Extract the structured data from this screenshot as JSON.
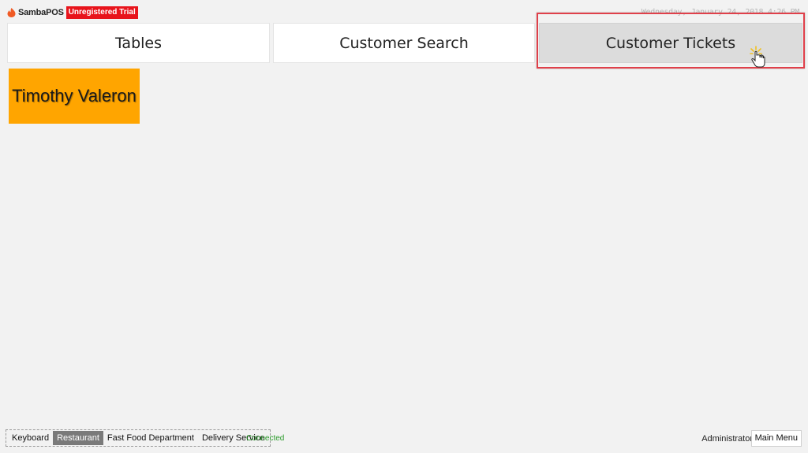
{
  "header": {
    "app_name": "SambaPOS",
    "trial_badge": "Unregistered Trial",
    "datetime": "Wednesday, January 24, 2018 4:26 PM"
  },
  "nav": {
    "buttons": [
      {
        "label": "Tables"
      },
      {
        "label": "Customer Search"
      },
      {
        "label": "Customer Tickets"
      }
    ],
    "active": "Customer Tickets"
  },
  "customers": [
    {
      "name": "Timothy Valeron",
      "color": "#ffa500"
    }
  ],
  "footer": {
    "departments": [
      "Keyboard",
      "Restaurant",
      "Fast Food Department",
      "Delivery Service"
    ],
    "selected_department": "Restaurant",
    "connection_status": "Connected",
    "user": "Administrator",
    "main_menu_label": "Main Menu"
  },
  "colors": {
    "background": "#f2f2f2",
    "trial_badge": "#e8141b",
    "customer_tile": "#ffa500",
    "highlight": "#e0404a",
    "connected": "#2a9a2a"
  },
  "icons": {
    "logo": "sambapos-flame-icon",
    "cursor": "hand-pointer-icon"
  }
}
